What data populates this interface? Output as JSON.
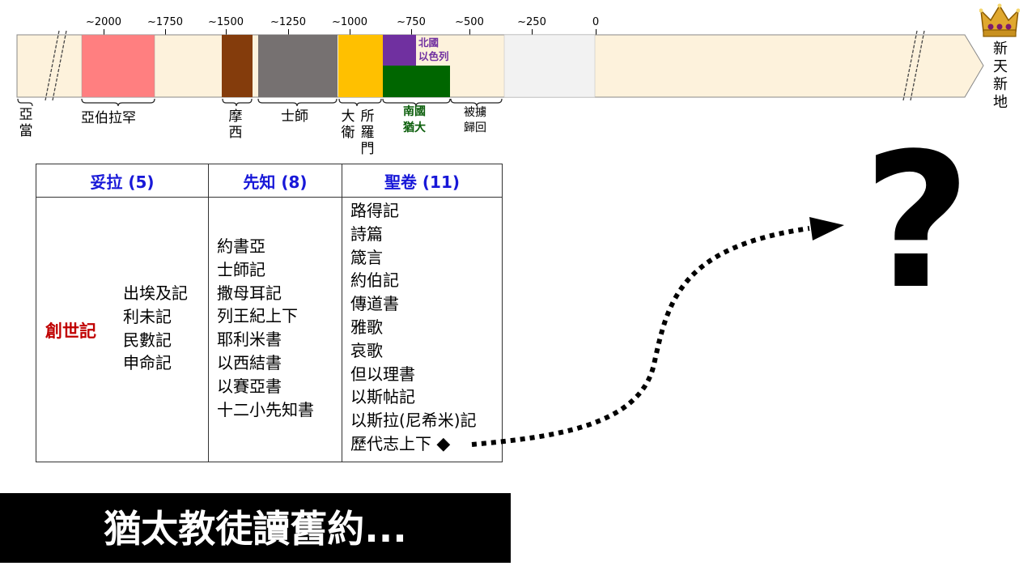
{
  "timeline": {
    "ticks": [
      {
        "label": "~2000"
      },
      {
        "label": "~1750"
      },
      {
        "label": "~1500"
      },
      {
        "label": "~1250"
      },
      {
        "label": "~1000"
      },
      {
        "label": "~750"
      },
      {
        "label": "~500"
      },
      {
        "label": "~250"
      },
      {
        "label": "0"
      }
    ],
    "north_label": "北國\n以色列",
    "south_label": "南國\n猶大",
    "periods": {
      "adam": "亞當",
      "abraham": "亞伯拉罕",
      "moses": "摩西",
      "judges": "士師",
      "david": "大衛",
      "solomon": "所羅門",
      "exile": "被擄\n歸回",
      "new_creation": "新天新地"
    },
    "colors": {
      "bar_bg": "#fdf2dc",
      "abraham": "#ff7f80",
      "moses": "#843c0c",
      "judges": "#767171",
      "kingdom": "#ffc000",
      "north": "#7030a0",
      "south": "#006600",
      "gray": "#f2f2f2"
    }
  },
  "table": {
    "headers": [
      "妥拉 (5)",
      "先知 (8)",
      "聖卷 (11)"
    ],
    "torah": {
      "genesis": "創世記",
      "others": [
        "出埃及記",
        "利未記",
        "民數記",
        "申命記"
      ]
    },
    "prophets": [
      "約書亞",
      "士師記",
      "撒母耳記",
      "列王紀上下",
      "耶利米書",
      "以西結書",
      "以賽亞書",
      "十二小先知書"
    ],
    "writings": [
      "路得記",
      "詩篇",
      "箴言",
      "約伯記",
      "傳道書",
      "雅歌",
      "哀歌",
      "但以理書",
      "以斯帖記",
      "以斯拉(尼希米)記",
      "歷代志上下"
    ]
  },
  "diamond": "◆",
  "question_mark": "?",
  "crown": "crown-icon",
  "banner": "猶太教徒讀舊約..."
}
